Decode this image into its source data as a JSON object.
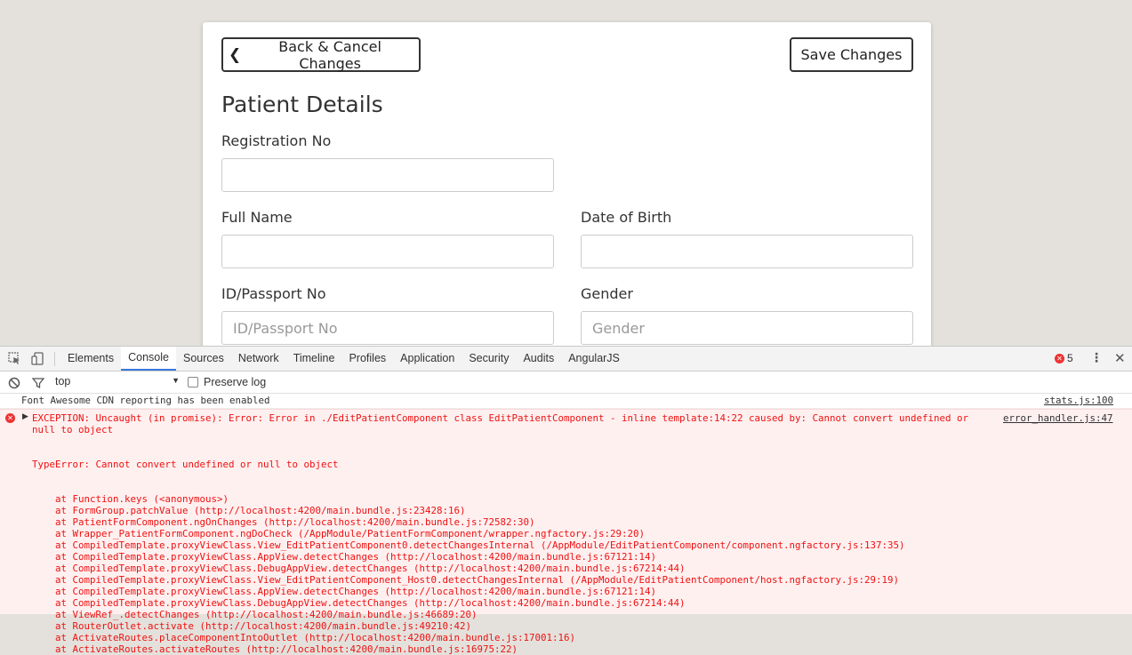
{
  "form": {
    "back_button": "Back & Cancel Changes",
    "save_button": "Save Changes",
    "title": "Patient Details",
    "fields": {
      "registration_no": {
        "label": "Registration No",
        "value": "",
        "placeholder": ""
      },
      "full_name": {
        "label": "Full Name",
        "value": "",
        "placeholder": ""
      },
      "date_of_birth": {
        "label": "Date of Birth",
        "value": "",
        "placeholder": ""
      },
      "id_passport_no": {
        "label": "ID/Passport No",
        "value": "",
        "placeholder": "ID/Passport No"
      },
      "gender": {
        "label": "Gender",
        "value": "",
        "placeholder": "Gender"
      }
    }
  },
  "devtools": {
    "tabs": [
      "Elements",
      "Console",
      "Sources",
      "Network",
      "Timeline",
      "Profiles",
      "Application",
      "Security",
      "Audits",
      "AngularJS"
    ],
    "active_tab": "Console",
    "error_count": "5",
    "context": "top",
    "preserve_log": "Preserve log",
    "preserve_log_checked": false,
    "messages": {
      "info": {
        "text": "Font Awesome CDN reporting has been enabled",
        "source": "stats.js:100"
      },
      "error": {
        "text": "EXCEPTION: Uncaught (in promise): Error: Error in ./EditPatientComponent class EditPatientComponent - inline template:14:22 caused by: Cannot convert undefined or null to object",
        "source": "error_handler.js:47",
        "stack_header": "TypeError: Cannot convert undefined or null to object",
        "stack": [
          "at Function.keys (<anonymous>)",
          "at FormGroup.patchValue (http://localhost:4200/main.bundle.js:23428:16)",
          "at PatientFormComponent.ngOnChanges (http://localhost:4200/main.bundle.js:72582:30)",
          "at Wrapper_PatientFormComponent.ngDoCheck (/AppModule/PatientFormComponent/wrapper.ngfactory.js:29:20)",
          "at CompiledTemplate.proxyViewClass.View_EditPatientComponent0.detectChangesInternal (/AppModule/EditPatientComponent/component.ngfactory.js:137:35)",
          "at CompiledTemplate.proxyViewClass.AppView.detectChanges (http://localhost:4200/main.bundle.js:67121:14)",
          "at CompiledTemplate.proxyViewClass.DebugAppView.detectChanges (http://localhost:4200/main.bundle.js:67214:44)",
          "at CompiledTemplate.proxyViewClass.View_EditPatientComponent_Host0.detectChangesInternal (/AppModule/EditPatientComponent/host.ngfactory.js:29:19)",
          "at CompiledTemplate.proxyViewClass.AppView.detectChanges (http://localhost:4200/main.bundle.js:67121:14)",
          "at CompiledTemplate.proxyViewClass.DebugAppView.detectChanges (http://localhost:4200/main.bundle.js:67214:44)",
          "at ViewRef_.detectChanges (http://localhost:4200/main.bundle.js:46689:20)",
          "at RouterOutlet.activate (http://localhost:4200/main.bundle.js:49210:42)",
          "at ActivateRoutes.placeComponentIntoOutlet (http://localhost:4200/main.bundle.js:17001:16)",
          "at ActivateRoutes.activateRoutes (http://localhost:4200/main.bundle.js:16975:22)"
        ]
      }
    }
  }
}
